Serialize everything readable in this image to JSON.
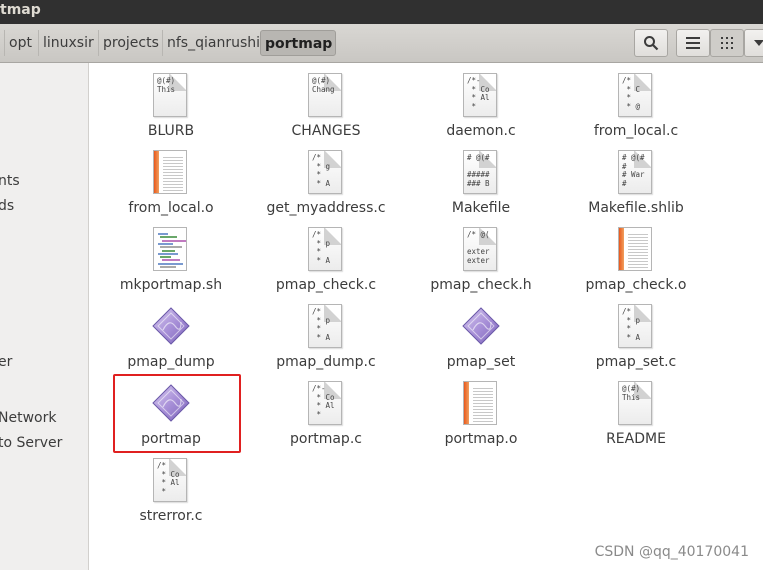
{
  "window": {
    "title": "tmap"
  },
  "breadcrumb": {
    "items": [
      "opt",
      "linuxsir",
      "projects",
      "nfs_qianrushi",
      "portmap"
    ]
  },
  "toolbar": {
    "search_icon": "search-icon",
    "list_view_icon": "list-view-icon",
    "grid_view_icon": "grid-view-icon"
  },
  "sidebar": {
    "items": [
      "nts",
      "ds",
      "er",
      "Network",
      "to Server"
    ]
  },
  "files": [
    {
      "name": "BLURB",
      "type": "text",
      "preview": "@(#)\nThis"
    },
    {
      "name": "CHANGES",
      "type": "text",
      "preview": "@(#)\nChang"
    },
    {
      "name": "daemon.c",
      "type": "text",
      "preview": "/*-\n * Co\n * Al\n *"
    },
    {
      "name": "from_local.c",
      "type": "text",
      "preview": "/*\n * C\n *\n * @"
    },
    {
      "name": "from_local.o",
      "type": "object"
    },
    {
      "name": "get_myaddress.c",
      "type": "text",
      "preview": "/*\n * g\n *\n * A"
    },
    {
      "name": "Makefile",
      "type": "text",
      "preview": "# @(#\n\n#####\n### B"
    },
    {
      "name": "Makefile.shlib",
      "type": "text",
      "preview": "# @(#\n#\n# War\n#"
    },
    {
      "name": "mkportmap.sh",
      "type": "script"
    },
    {
      "name": "pmap_check.c",
      "type": "text",
      "preview": "/*\n * p\n *\n * A"
    },
    {
      "name": "pmap_check.h",
      "type": "text",
      "preview": "/* @(\n\nexter\nexter"
    },
    {
      "name": "pmap_check.o",
      "type": "object"
    },
    {
      "name": "pmap_dump",
      "type": "executable"
    },
    {
      "name": "pmap_dump.c",
      "type": "text",
      "preview": "/*\n * p\n *\n * A"
    },
    {
      "name": "pmap_set",
      "type": "executable"
    },
    {
      "name": "pmap_set.c",
      "type": "text",
      "preview": "/*\n * p\n *\n * A"
    },
    {
      "name": "portmap",
      "type": "executable"
    },
    {
      "name": "portmap.c",
      "type": "text",
      "preview": "/*-\n * Co\n * Al\n *"
    },
    {
      "name": "portmap.o",
      "type": "object"
    },
    {
      "name": "README",
      "type": "text",
      "preview": "@(#)\nThis"
    },
    {
      "name": "strerror.c",
      "type": "text",
      "preview": "/*\n * Co\n * Al\n *"
    }
  ],
  "selected_file": "portmap",
  "watermark": "CSDN @qq_40170041"
}
